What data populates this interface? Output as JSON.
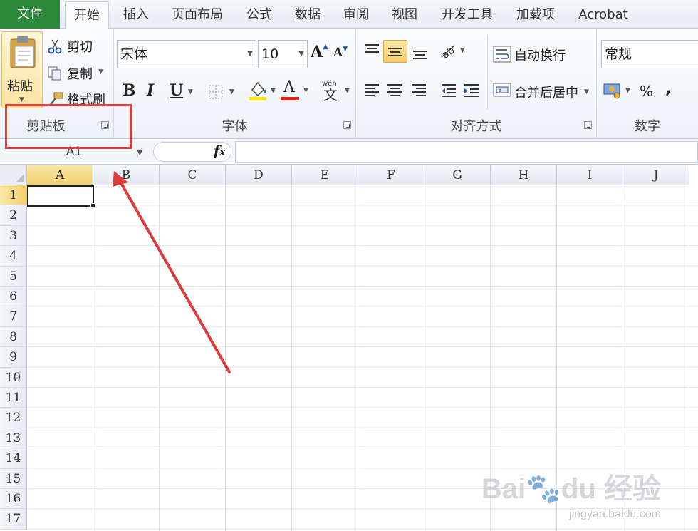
{
  "tabs": {
    "file": "文件",
    "items": [
      "开始",
      "插入",
      "页面布局",
      "公式",
      "数据",
      "审阅",
      "视图",
      "开发工具",
      "加载项",
      "Acrobat"
    ]
  },
  "clipboard": {
    "paste": "粘贴",
    "cut": "剪切",
    "copy": "复制",
    "format_painter": "格式刷",
    "group_label": "剪贴板"
  },
  "font": {
    "name": "宋体",
    "size": "10",
    "bold": "B",
    "italic": "I",
    "underline": "U",
    "group_label": "字体"
  },
  "alignment": {
    "wrap_text": "自动换行",
    "merge_center": "合并后居中",
    "group_label": "对齐方式"
  },
  "number": {
    "format": "常规",
    "percent": "%",
    "comma": ",",
    "group_label": "数字"
  },
  "formula_bar": {
    "name_box": "A1",
    "fx": "fx",
    "content": ""
  },
  "sheet": {
    "columns": [
      "A",
      "B",
      "C",
      "D",
      "E",
      "F",
      "G",
      "H",
      "I",
      "J"
    ],
    "rows": [
      "1",
      "2",
      "3",
      "4",
      "5",
      "6",
      "7",
      "8",
      "9",
      "10",
      "11",
      "12",
      "13",
      "14",
      "15",
      "16",
      "17"
    ],
    "active_cell": "A1"
  },
  "watermark": {
    "logo": "Bai du 经验",
    "url": "jingyan.baidu.com"
  },
  "colors": {
    "file_tab": "#2a8a3a",
    "highlight": "#e03b3b",
    "selected_header": "#f3cf6c",
    "font_color_bar": "#e02020",
    "fill_color_bar": "#ffe600"
  }
}
